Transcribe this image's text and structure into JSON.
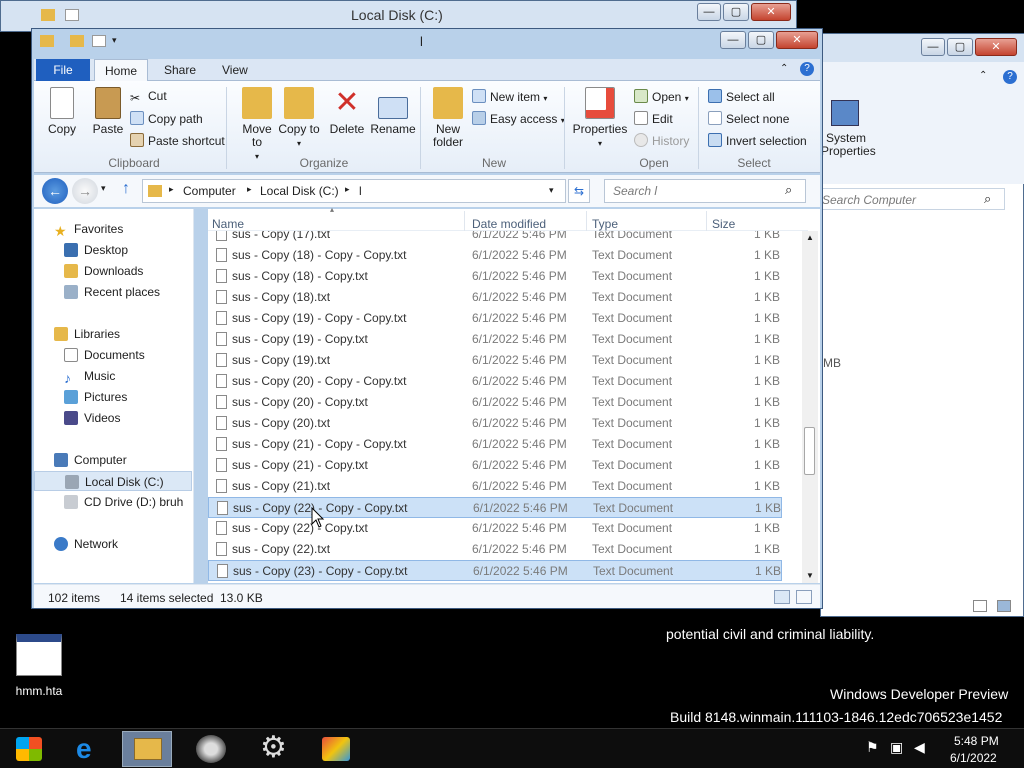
{
  "back_window_1": {
    "title": "Local Disk (C:)"
  },
  "back_window_2": {
    "search_placeholder": "Search Computer",
    "ribbon_item": "System Properties",
    "fragment": "MB"
  },
  "main_window": {
    "title": "l",
    "ribbon_tabs": [
      "File",
      "Home",
      "Share",
      "View"
    ],
    "active_tab": "Home",
    "clipboard": {
      "copy": "Copy",
      "paste": "Paste",
      "cut": "Cut",
      "copy_path": "Copy path",
      "paste_shortcut": "Paste shortcut",
      "group": "Clipboard"
    },
    "organize": {
      "move_to": "Move to",
      "copy_to": "Copy to",
      "delete": "Delete",
      "rename": "Rename",
      "group": "Organize"
    },
    "new": {
      "new_folder": "New folder",
      "new_item": "New item",
      "easy_access": "Easy access",
      "group": "New"
    },
    "open": {
      "properties": "Properties",
      "open": "Open",
      "edit": "Edit",
      "history": "History",
      "group": "Open"
    },
    "select": {
      "select_all": "Select all",
      "select_none": "Select none",
      "invert": "Invert selection",
      "group": "Select"
    },
    "address": {
      "crumbs": [
        "Computer",
        "Local Disk (C:)",
        "l"
      ]
    },
    "search_placeholder": "Search l",
    "nav": {
      "favorites": "Favorites",
      "desktop": "Desktop",
      "downloads": "Downloads",
      "recent": "Recent places",
      "libraries": "Libraries",
      "documents": "Documents",
      "music": "Music",
      "pictures": "Pictures",
      "videos": "Videos",
      "computer": "Computer",
      "local_disk": "Local Disk (C:)",
      "cd_drive": "CD Drive (D:) bruh",
      "network": "Network"
    },
    "columns": {
      "name": "Name",
      "date": "Date modified",
      "type": "Type",
      "size": "Size"
    },
    "files": [
      {
        "name": "sus - Copy (17).txt",
        "date": "6/1/2022 5:46 PM",
        "type": "Text Document",
        "size": "1 KB"
      },
      {
        "name": "sus - Copy (18) - Copy - Copy.txt",
        "date": "6/1/2022 5:46 PM",
        "type": "Text Document",
        "size": "1 KB"
      },
      {
        "name": "sus - Copy (18) - Copy.txt",
        "date": "6/1/2022 5:46 PM",
        "type": "Text Document",
        "size": "1 KB"
      },
      {
        "name": "sus - Copy (18).txt",
        "date": "6/1/2022 5:46 PM",
        "type": "Text Document",
        "size": "1 KB"
      },
      {
        "name": "sus - Copy (19) - Copy - Copy.txt",
        "date": "6/1/2022 5:46 PM",
        "type": "Text Document",
        "size": "1 KB"
      },
      {
        "name": "sus - Copy (19) - Copy.txt",
        "date": "6/1/2022 5:46 PM",
        "type": "Text Document",
        "size": "1 KB"
      },
      {
        "name": "sus - Copy (19).txt",
        "date": "6/1/2022 5:46 PM",
        "type": "Text Document",
        "size": "1 KB"
      },
      {
        "name": "sus - Copy (20) - Copy - Copy.txt",
        "date": "6/1/2022 5:46 PM",
        "type": "Text Document",
        "size": "1 KB"
      },
      {
        "name": "sus - Copy (20) - Copy.txt",
        "date": "6/1/2022 5:46 PM",
        "type": "Text Document",
        "size": "1 KB"
      },
      {
        "name": "sus - Copy (20).txt",
        "date": "6/1/2022 5:46 PM",
        "type": "Text Document",
        "size": "1 KB"
      },
      {
        "name": "sus - Copy (21) - Copy - Copy.txt",
        "date": "6/1/2022 5:46 PM",
        "type": "Text Document",
        "size": "1 KB"
      },
      {
        "name": "sus - Copy (21) - Copy.txt",
        "date": "6/1/2022 5:46 PM",
        "type": "Text Document",
        "size": "1 KB"
      },
      {
        "name": "sus - Copy (21).txt",
        "date": "6/1/2022 5:46 PM",
        "type": "Text Document",
        "size": "1 KB"
      },
      {
        "name": "sus - Copy (22) - Copy - Copy.txt",
        "date": "6/1/2022 5:46 PM",
        "type": "Text Document",
        "size": "1 KB",
        "selected": true
      },
      {
        "name": "sus - Copy (22) - Copy.txt",
        "date": "6/1/2022 5:46 PM",
        "type": "Text Document",
        "size": "1 KB"
      },
      {
        "name": "sus - Copy (22).txt",
        "date": "6/1/2022 5:46 PM",
        "type": "Text Document",
        "size": "1 KB"
      },
      {
        "name": "sus - Copy (23) - Copy - Copy.txt",
        "date": "6/1/2022 5:46 PM",
        "type": "Text Document",
        "size": "1 KB",
        "selected": true
      }
    ],
    "status": {
      "items": "102 items",
      "selected": "14 items selected",
      "size": "13.0 KB"
    }
  },
  "desktop": {
    "icon_label": "hmm.hta",
    "legal_text": "potential civil and criminal liability.",
    "watermark_1": "Windows Developer Preview",
    "watermark_2": "Build 8148.winmain.111103-1846.12edc706523e1452"
  },
  "taskbar": {
    "time": "5:48 PM",
    "date": "6/1/2022"
  },
  "colors": {
    "ribbon_file_tab": "#1f5fbf",
    "selection": "#cce1f7",
    "title_frame": "#b9d1ea",
    "delete_icon": "#d0302a",
    "folder": "#e6b84a"
  }
}
